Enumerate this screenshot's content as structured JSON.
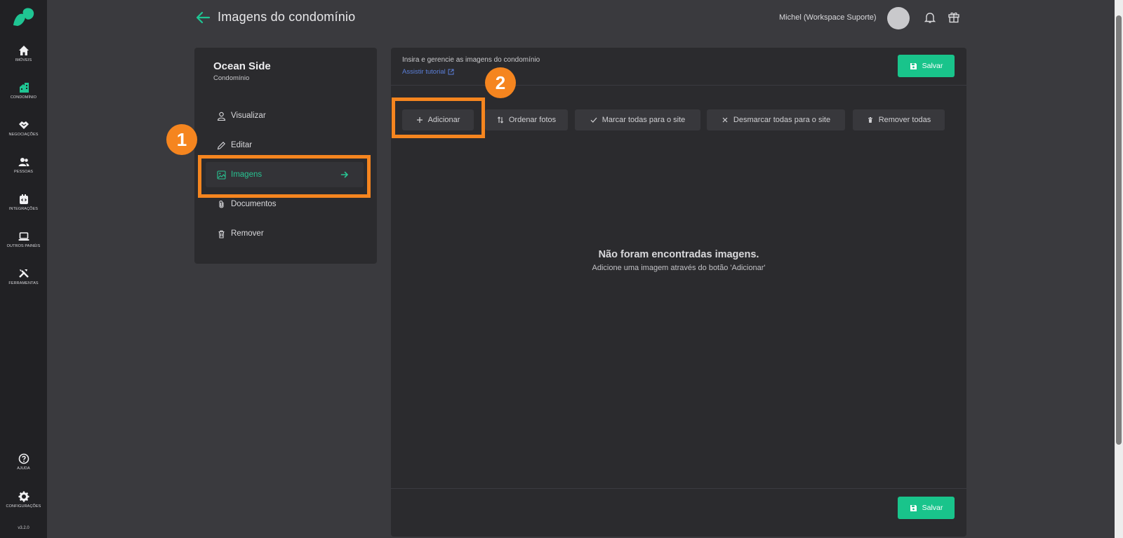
{
  "nav": {
    "items": [
      {
        "label": "IMÓVEIS",
        "icon": "home-icon"
      },
      {
        "label": "CONDOMÍNIO",
        "icon": "building-icon"
      },
      {
        "label": "NEGOCIAÇÕES",
        "icon": "handshake-icon"
      },
      {
        "label": "PESSOAS",
        "icon": "people-icon"
      },
      {
        "label": "INTEGRAÇÕES",
        "icon": "integration-icon"
      },
      {
        "label": "OUTROS PAINÉIS",
        "icon": "laptop-icon"
      },
      {
        "label": "FERRAMENTAS",
        "icon": "tools-icon"
      }
    ],
    "bottom": [
      {
        "label": "AJUDA",
        "icon": "help-icon"
      },
      {
        "label": "CONFIGURAÇÕES",
        "icon": "gear-icon"
      }
    ],
    "version": "v3.2.0"
  },
  "header": {
    "title": "Imagens do condomínio",
    "user": "Michel (Workspace Suporte)"
  },
  "side": {
    "title": "Ocean Side",
    "subtitle": "Condomínio",
    "items": [
      {
        "label": "Visualizar"
      },
      {
        "label": "Editar"
      },
      {
        "label": "Imagens"
      },
      {
        "label": "Documentos"
      },
      {
        "label": "Remover"
      }
    ]
  },
  "main": {
    "description": "Insira e gerencie as imagens do condomínio",
    "tutorial": "Assistir tutorial",
    "save": "Salvar",
    "toolbar": {
      "add": "Adicionar",
      "order": "Ordenar fotos",
      "mark_all": "Marcar todas para o site",
      "unmark_all": "Desmarcar todas para o site",
      "remove_all": "Remover todas"
    },
    "empty_title": "Não foram encontradas imagens.",
    "empty_sub": "Adicione uma imagem através do botão 'Adicionar'"
  },
  "annotations": {
    "step1": "1",
    "step2": "2"
  },
  "colors": {
    "accent": "#19c48b",
    "highlight": "#f5851f",
    "link": "#5b7fd9"
  }
}
